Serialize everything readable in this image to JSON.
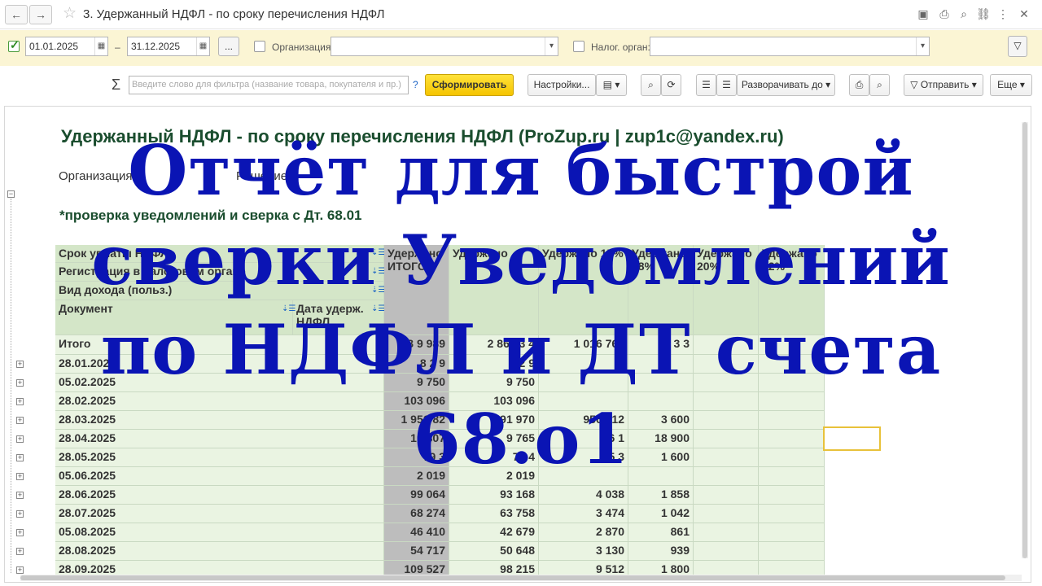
{
  "window": {
    "title": "3. Удержанный НДФЛ - по сроку перечисления НДФЛ",
    "back_icon": "←",
    "forward_icon": "→",
    "star_icon": "☆"
  },
  "filters": {
    "period_enabled": true,
    "date_from": "01.01.2025",
    "date_separator": "–",
    "date_to": "31.12.2025",
    "ellipsis_label": "...",
    "org_label": "Организация:",
    "org_value": "",
    "tax_label": "Налог. орган:",
    "tax_value": ""
  },
  "toolbar": {
    "sigma": "Σ",
    "search_placeholder": "Введите слово для фильтра (название товара, покупателя и пр.)",
    "help": "?",
    "generate_label": "Сформировать",
    "settings_label": "Настройки...",
    "expand_label": "Разворачивать до",
    "send_label": "Отправить",
    "more_label": "Еще"
  },
  "report": {
    "title": "Удержанный НДФЛ - по сроку перечисления НДФЛ (ProZup.ru | zup1c@yandex.ru)",
    "param_org_label": "Организация",
    "param_decision_label": "Решение",
    "subtitle": "*проверка уведомлений и сверка с Дт. 68.01",
    "headers": {
      "row1": "Срок уплаты НДФЛ",
      "row2": "Регистрация в налоговом органе",
      "row3": "Вид дохода (польз.)",
      "row4a": "Документ",
      "row4b": "Дата удерж. НДФЛ",
      "c1": "Удержано ИТОГО",
      "c2": "Удержано",
      "c3": "Удержано 15%",
      "c4": "Удержано 18%",
      "c5": "Удержано 20%",
      "c6": "Удержано 22%"
    },
    "total": {
      "label": "Итого",
      "c1": "3 9 989",
      "c2": "2 868 3 4",
      "c3": "1 016 762",
      "c4": "51 3 3",
      "c5": "",
      "c6": ""
    },
    "rows": [
      {
        "date": "28.01.2025",
        "c1": "8 2 9",
        "c2": "8 2 9",
        "c3": "",
        "c4": ""
      },
      {
        "date": "05.02.2025",
        "c1": "9 750",
        "c2": "9 750",
        "c3": "",
        "c4": ""
      },
      {
        "date": "28.02.2025",
        "c1": "103 096",
        "c2": "103 096",
        "c3": "",
        "c4": ""
      },
      {
        "date": "28.03.2025",
        "c1": "1 951 82",
        "c2": "991 970",
        "c3": "956 012",
        "c4": "3 600"
      },
      {
        "date": "28.04.2025",
        "c1": "10 807",
        "c2": "9 765",
        "c3": "6 1",
        "c4": "18 900"
      },
      {
        "date": "28.05.2025",
        "c1": "79 3",
        "c2": "72 4",
        "c3": "5 3",
        "c4": "1 600"
      },
      {
        "date": "05.06.2025",
        "c1": "2 019",
        "c2": "2 019",
        "c3": "",
        "c4": ""
      },
      {
        "date": "28.06.2025",
        "c1": "99 064",
        "c2": "93 168",
        "c3": "4 038",
        "c4": "1 858"
      },
      {
        "date": "28.07.2025",
        "c1": "68 274",
        "c2": "63 758",
        "c3": "3 474",
        "c4": "1 042"
      },
      {
        "date": "05.08.2025",
        "c1": "46 410",
        "c2": "42 679",
        "c3": "2 870",
        "c4": "861"
      },
      {
        "date": "28.08.2025",
        "c1": "54 717",
        "c2": "50 648",
        "c3": "3 130",
        "c4": "939"
      },
      {
        "date": "28.09.2025",
        "c1": "109 527",
        "c2": "98 215",
        "c3": "9 512",
        "c4": "1 800"
      }
    ]
  },
  "overlay": {
    "line1": "Отчёт для быстрой",
    "line2": "сверки Уведомлений",
    "line3": "по НДФЛ и ДТ счета",
    "line4": "68.о1"
  }
}
